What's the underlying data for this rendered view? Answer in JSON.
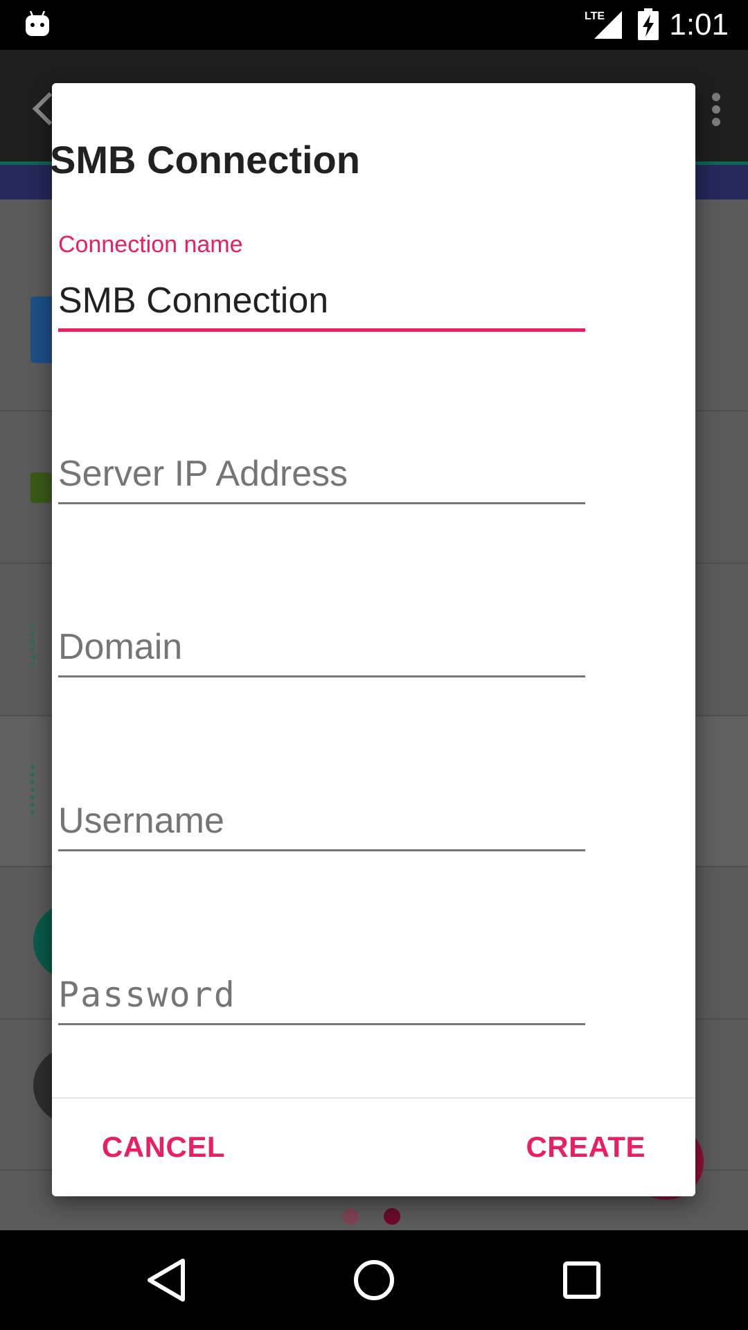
{
  "status_bar": {
    "time": "1:01",
    "network": "LTE",
    "icons": [
      "android-icon",
      "lte-signal-icon",
      "battery-charging-icon"
    ]
  },
  "dialog": {
    "title": "SMB Connection",
    "fields": {
      "connection_name": {
        "label": "Connection name",
        "value": "SMB Connection"
      },
      "server_ip": {
        "placeholder": "Server IP Address"
      },
      "domain": {
        "placeholder": "Domain"
      },
      "username": {
        "placeholder": "Username"
      },
      "password": {
        "placeholder": "Password"
      }
    },
    "buttons": {
      "cancel": "CANCEL",
      "create": "CREATE"
    }
  },
  "nav_bar": {
    "icons": [
      "back-icon",
      "home-icon",
      "recents-icon"
    ]
  },
  "colors": {
    "accent": "#e91e63",
    "title_text": "#212121",
    "placeholder_text": "#757575",
    "scrim_background": "#5b5b5b",
    "bar_background": "#000000"
  }
}
